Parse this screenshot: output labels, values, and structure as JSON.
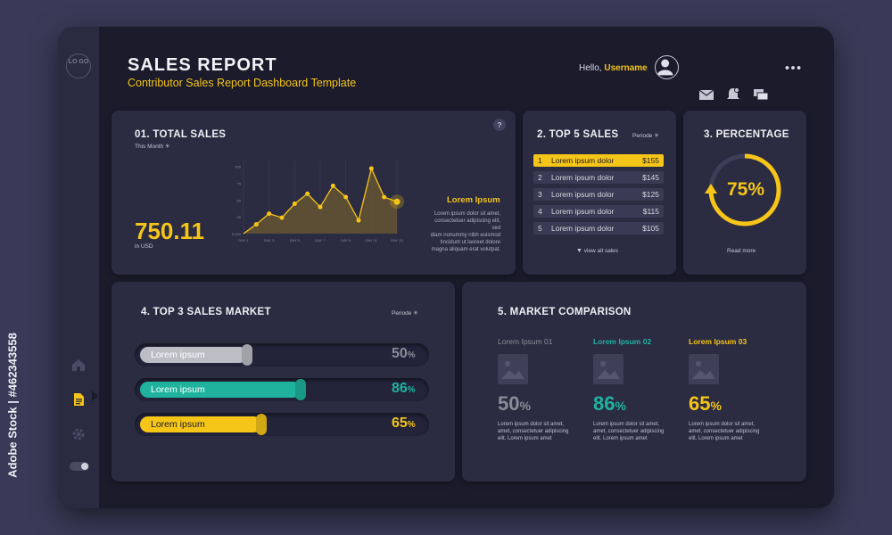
{
  "header": {
    "title": "SALES REPORT",
    "subtitle": "Contributor Sales Report Dashboard Template",
    "greeting": "Hello,",
    "username": "Username"
  },
  "sidebar": {
    "logo_text": "LO GO",
    "items": [
      {
        "icon": "home-icon"
      },
      {
        "icon": "document-icon",
        "active": true
      },
      {
        "icon": "settings-icon"
      }
    ]
  },
  "total_sales": {
    "title": "01. TOTAL SALES",
    "period": "This Month",
    "value": "750.11",
    "unit": "in USD",
    "help": "?",
    "legend_title": "Lorem Ipsum",
    "legend_text": [
      "Lorem ipsum dolor sit amet,",
      "consectetuer adipiscing elit, sed",
      "diam nonummy nibh euismod",
      "tincidunt ut laoreet dolore",
      "magna aliquam erat volutpat."
    ]
  },
  "chart_data": {
    "type": "line",
    "x": [
      "DAY 1",
      "DAY 2",
      "DAY 3",
      "DAY 4",
      "DAY 5",
      "DAY 6",
      "DAY 7",
      "DAY 8",
      "DAY 9",
      "DAY 10",
      "DAY 11",
      "DAY 12",
      "DAY 13"
    ],
    "x_tick_labels": [
      "DAY 1",
      "DAY 3",
      "DAY 5",
      "DAY 7",
      "DAY 9",
      "DAY 11",
      "DAY 13"
    ],
    "y_tick_labels": [
      "0.000",
      "25",
      "50",
      "75",
      "100"
    ],
    "values": [
      0,
      14,
      30,
      24,
      45,
      60,
      40,
      72,
      55,
      20,
      98,
      55,
      48
    ],
    "ylim": [
      0,
      110
    ],
    "color": "#f5c518"
  },
  "top_sales": {
    "title": "2. TOP 5 SALES",
    "period": "Periode",
    "rows": [
      {
        "rank": "1",
        "name": "Lorem ipsum dolor",
        "value": "$155"
      },
      {
        "rank": "2",
        "name": "Lorem ipsum dolor",
        "value": "$145"
      },
      {
        "rank": "3",
        "name": "Lorem ipsum dolor",
        "value": "$125"
      },
      {
        "rank": "4",
        "name": "Lorem ipsum dolor",
        "value": "$115"
      },
      {
        "rank": "5",
        "name": "Lorem ipsum dolor",
        "value": "$105"
      }
    ],
    "view_all": "view all sales"
  },
  "percentage": {
    "title": "3. PERCENTAGE",
    "value": "75%",
    "progress": 0.75,
    "read_more": "Read more"
  },
  "market": {
    "title": "4. TOP 3 SALES MARKET",
    "period": "Periode",
    "bars": [
      {
        "label": "Lorem ipsum",
        "pct": "50",
        "unit": "%",
        "progress": 0.5,
        "color": "#bdbdc6",
        "text_color": "#8c8c98"
      },
      {
        "label": "Lorem ipsum",
        "pct": "86",
        "unit": "%",
        "progress": 0.86,
        "color": "#1fb39e",
        "text_color": "#1fb39e"
      },
      {
        "label": "Lorem ipsum",
        "pct": "65",
        "unit": "%",
        "progress": 0.65,
        "color": "#f5c518",
        "text_color": "#f5c518"
      }
    ]
  },
  "comparison": {
    "title": "5. MARKET COMPARISON",
    "items": [
      {
        "label": "Lorem Ipsum 01",
        "pct": "50",
        "unit": "%",
        "color": "#8c8c98",
        "text": [
          "Lorem ipsum dolor sit amet,",
          "amet, consectetuer adipiscing",
          "elit. Lorem ipsum  amet"
        ]
      },
      {
        "label": "Lorem Ipsum 02",
        "pct": "86",
        "unit": "%",
        "color": "#1fb39e",
        "text": [
          "Lorem ipsum dolor sit amet,",
          "amet, consectetuer adipiscing",
          "elit. Lorem ipsum  amet"
        ]
      },
      {
        "label": "Lorem Ipsum 03",
        "pct": "65",
        "unit": "%",
        "color": "#f5c518",
        "text": [
          "Lorem ipsum dolor sit amet,",
          "amet, consectetuer adipiscing",
          "elit. Lorem ipsum  amet"
        ]
      }
    ]
  },
  "watermark": {
    "text": "Adobe Stock",
    "side_text": "Adobe Stock | #462343558"
  }
}
